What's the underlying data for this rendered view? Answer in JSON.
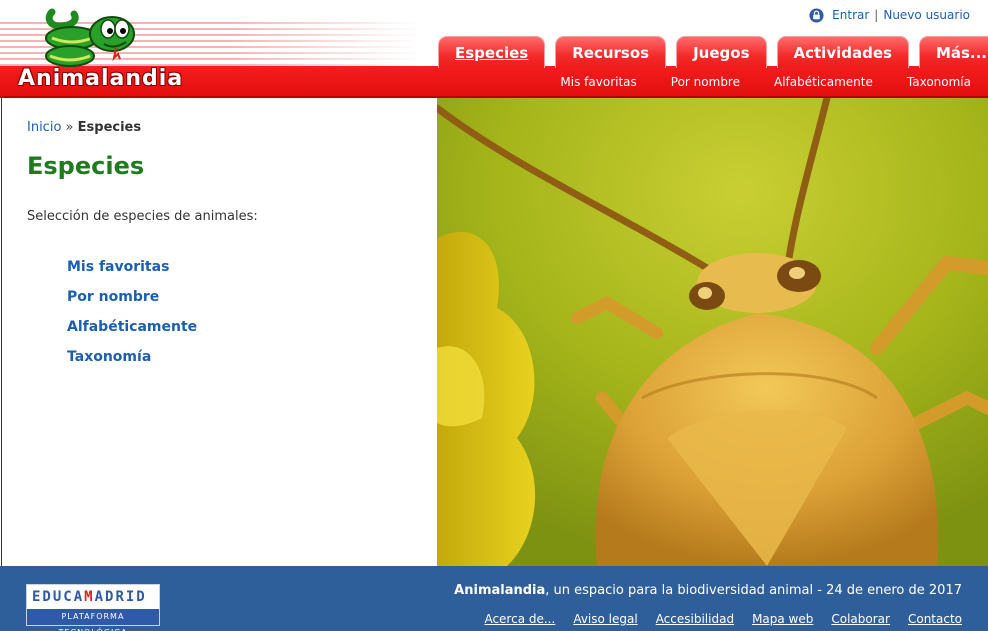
{
  "site": {
    "logo_text": "Animalandia"
  },
  "user_links": {
    "login": "Entrar",
    "separator": "|",
    "register": "Nuevo usuario"
  },
  "tabs": [
    {
      "label": "Especies",
      "active": true
    },
    {
      "label": "Recursos",
      "active": false
    },
    {
      "label": "Juegos",
      "active": false
    },
    {
      "label": "Actividades",
      "active": false
    },
    {
      "label": "Más...",
      "active": false
    }
  ],
  "subnav": [
    {
      "label": "Mis favoritas"
    },
    {
      "label": "Por nombre"
    },
    {
      "label": "Alfabéticamente"
    },
    {
      "label": "Taxonomía"
    }
  ],
  "breadcrumb": {
    "home": "Inicio",
    "separator": "»",
    "current": "Especies"
  },
  "main": {
    "title": "Especies",
    "intro": "Selección de especies de animales:",
    "links": [
      {
        "label": "Mis favoritas"
      },
      {
        "label": "Por nombre"
      },
      {
        "label": "Alfabéticamente"
      },
      {
        "label": "Taxonomía"
      }
    ]
  },
  "footer": {
    "logo_brand_a": "EDUCA",
    "logo_brand_m": "M",
    "logo_brand_b": "ADRID",
    "logo_sub": "PLATAFORMA TECNOLÓGICA",
    "site_name": "Animalandia",
    "tagline": ", un espacio para la biodiversidad animal - 24 de enero de 2017",
    "links": [
      {
        "label": "Acerca de..."
      },
      {
        "label": "Aviso legal"
      },
      {
        "label": "Accesibilidad"
      },
      {
        "label": "Mapa web"
      },
      {
        "label": "Colaborar"
      },
      {
        "label": "Contacto"
      }
    ]
  },
  "colors": {
    "header_red": "#ee1b1b",
    "link_blue": "#1a5fb4",
    "title_green": "#1e7b1e",
    "footer_blue": "#2f5f9a"
  },
  "icons": {
    "lock": "lock-icon",
    "logo": "snake-logo"
  }
}
